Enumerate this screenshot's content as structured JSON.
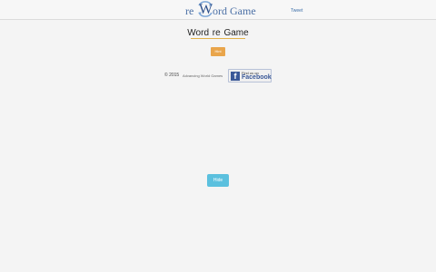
{
  "header": {
    "logo_prefix": "re",
    "logo_letter": "W",
    "logo_suffix": "ord Game",
    "tweet_label": "Tweet"
  },
  "main": {
    "title": "Word  re  Game",
    "hint_label": "Hint"
  },
  "footer": {
    "copyright": "© 2015",
    "company": "Advancing World Games",
    "facebook_small": "Find us on",
    "facebook_big": "Facebook"
  },
  "bottom": {
    "hide_label": "Hide"
  },
  "colors": {
    "accent": "#e9a54b",
    "hide_button": "#5bc0de",
    "logo": "#4a6fa5",
    "facebook": "#3b5998"
  },
  "icons": {
    "logo_ring": "circular-arrows-icon",
    "facebook": "facebook-f-icon"
  }
}
